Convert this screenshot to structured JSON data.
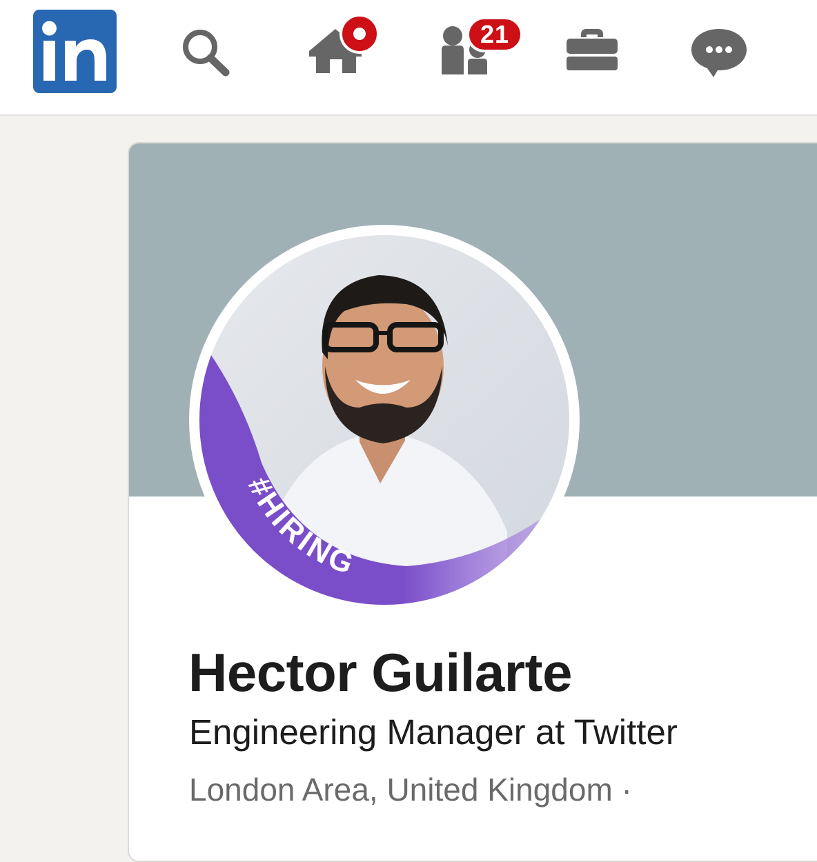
{
  "nav": {
    "logo_text": "in",
    "items": [
      {
        "name": "search",
        "icon": "search-icon"
      },
      {
        "name": "home",
        "icon": "home-icon",
        "badge": "dot"
      },
      {
        "name": "my-network",
        "icon": "people-icon",
        "badge": "21"
      },
      {
        "name": "jobs",
        "icon": "briefcase-icon"
      },
      {
        "name": "messaging",
        "icon": "chat-bubble-icon"
      }
    ]
  },
  "colors": {
    "brand": "#2867b2",
    "icon": "#666666",
    "badge": "#cc1016",
    "cover": "#a0b1b5",
    "hiring_frame": "#7a4dc9"
  },
  "profile": {
    "name": "Hector Guilarte",
    "headline": "Engineering Manager at Twitter",
    "location": "London Area, United Kingdom ·",
    "photo_frame_label": "#HIRING"
  }
}
